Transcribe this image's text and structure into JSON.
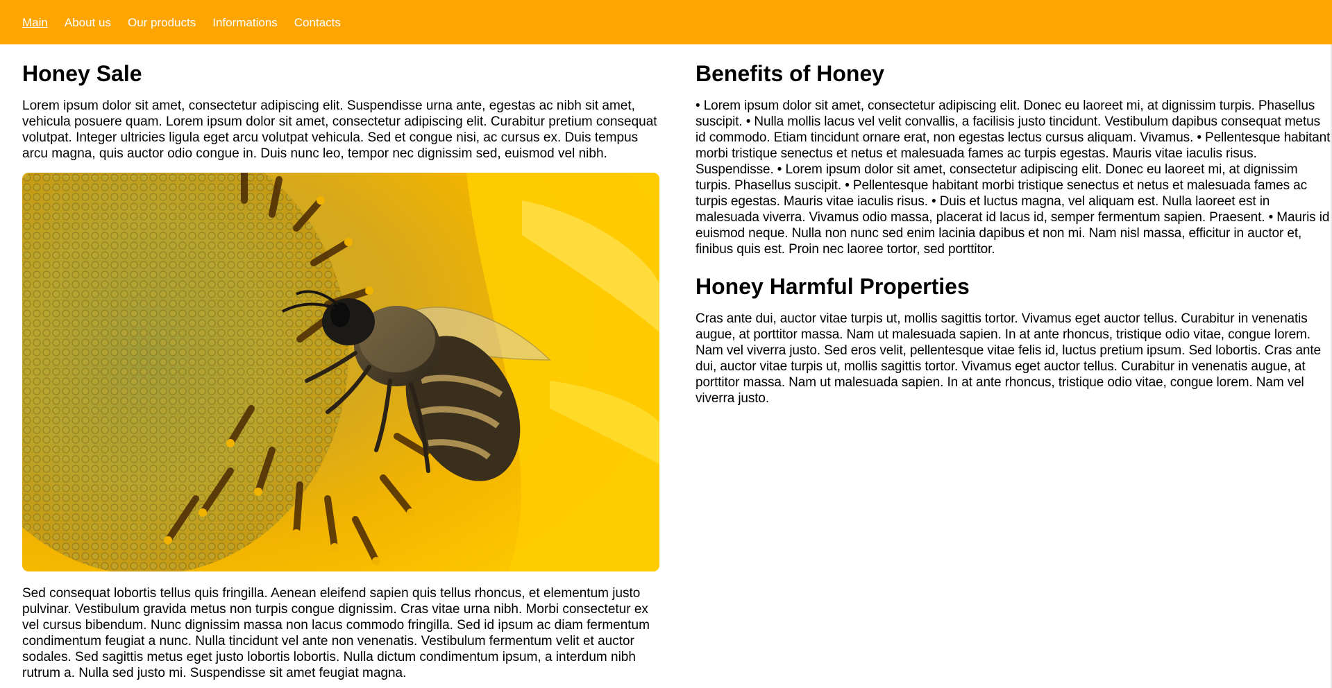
{
  "nav": {
    "items": [
      "Main",
      "About us",
      "Our products",
      "Informations",
      "Contacts"
    ]
  },
  "colors": {
    "navbar": "#ffa500",
    "nav_text": "#ffffff"
  },
  "left": {
    "title": "Honey Sale",
    "intro": "Lorem ipsum dolor sit amet, consectetur adipiscing elit. Suspendisse urna ante, egestas ac nibh sit amet, vehicula posuere quam. Lorem ipsum dolor sit amet, consectetur adipiscing elit. Curabitur pretium consequat volutpat. Integer ultricies ligula eget arcu volutpat vehicula. Sed et congue nisi, ac cursus ex. Duis tempus arcu magna, quis auctor odio congue in. Duis nunc leo, tempor nec dignissim sed, euismod vel nibh.",
    "image": "bee-on-sunflower",
    "after_image": "Sed consequat lobortis tellus quis fringilla. Aenean eleifend sapien quis tellus rhoncus, et elementum justo pulvinar. Vestibulum gravida metus non turpis congue dignissim. Cras vitae urna nibh. Morbi consectetur ex vel cursus bibendum. Nunc dignissim massa non lacus commodo fringilla. Sed id ipsum ac diam fermentum condimentum feugiat a nunc. Nulla tincidunt vel ante non venenatis. Vestibulum fermentum velit et auctor sodales. Sed sagittis metus eget justo lobortis lobortis. Nulla dictum condimentum ipsum, a interdum nibh rutrum a. Nulla sed justo mi. Suspendisse sit amet feugiat magna."
  },
  "right": {
    "benefits_title": "Benefits of Honey",
    "benefits_text": "• Lorem ipsum dolor sit amet, consectetur adipiscing elit. Donec eu laoreet mi, at dignissim turpis. Phasellus suscipit. • Nulla mollis lacus vel velit convallis, a facilisis justo tincidunt. Vestibulum dapibus consequat metus id commodo. Etiam tincidunt ornare erat, non egestas lectus cursus aliquam. Vivamus. • Pellentesque habitant morbi tristique senectus et netus et malesuada fames ac turpis egestas. Mauris vitae iaculis risus. Suspendisse. • Lorem ipsum dolor sit amet, consectetur adipiscing elit. Donec eu laoreet mi, at dignissim turpis. Phasellus suscipit. • Pellentesque habitant morbi tristique senectus et netus et malesuada fames ac turpis egestas. Mauris vitae iaculis risus. • Duis et luctus magna, vel aliquam est. Nulla laoreet est in malesuada viverra. Vivamus odio massa, placerat id lacus id, semper fermentum sapien. Praesent. • Mauris id euismod neque. Nulla non nunc sed enim lacinia dapibus et non mi. Nam nisl massa, efficitur in auctor et, finibus quis est. Proin nec laoree tortor, sed porttitor.",
    "harmful_title": "Honey Harmful Properties",
    "harmful_text": "Cras ante dui, auctor vitae turpis ut, mollis sagittis tortor. Vivamus eget auctor tellus. Curabitur in venenatis augue, at porttitor massa. Nam ut malesuada sapien. In at ante rhoncus, tristique odio vitae, congue lorem. Nam vel viverra justo. Sed eros velit, pellentesque vitae felis id, luctus pretium ipsum. Sed lobortis. Cras ante dui, auctor vitae turpis ut, mollis sagittis tortor. Vivamus eget auctor tellus. Curabitur in venenatis augue, at porttitor massa. Nam ut malesuada sapien. In at ante rhoncus, tristique odio vitae, congue lorem. Nam vel viverra justo."
  }
}
